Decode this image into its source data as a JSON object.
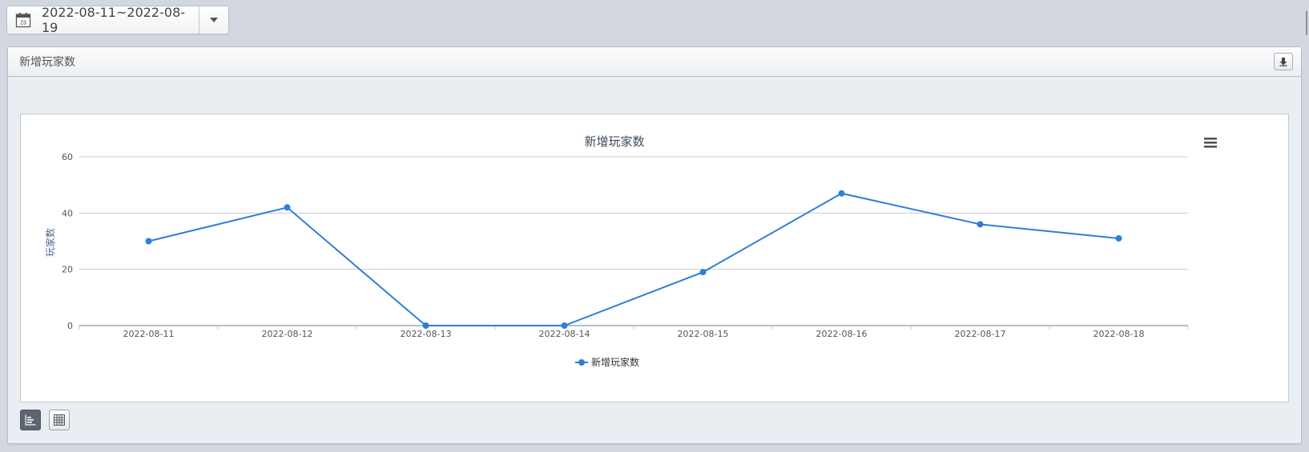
{
  "date_range": {
    "value": "2022-08-11~2022-08-19",
    "icon": "calendar-icon",
    "calendar_day": "23"
  },
  "panel": {
    "title": "新增玩家数"
  },
  "chart_data": {
    "type": "line",
    "title": "新增玩家数",
    "xlabel": "",
    "ylabel": "玩家数",
    "categories": [
      "2022-08-11",
      "2022-08-12",
      "2022-08-13",
      "2022-08-14",
      "2022-08-15",
      "2022-08-16",
      "2022-08-17",
      "2022-08-18"
    ],
    "series": [
      {
        "name": "新增玩家数",
        "values": [
          30,
          42,
          0,
          0,
          19,
          47,
          36,
          31
        ],
        "color": "#2f7ed8"
      }
    ],
    "ylim": [
      0,
      60
    ],
    "yticks": [
      0,
      20,
      40,
      60
    ],
    "grid": true,
    "legend": "bottom-center"
  },
  "colors": {
    "series": "#2f7ed8",
    "grid": "#c8ccd2",
    "axis_text": "#555555"
  }
}
